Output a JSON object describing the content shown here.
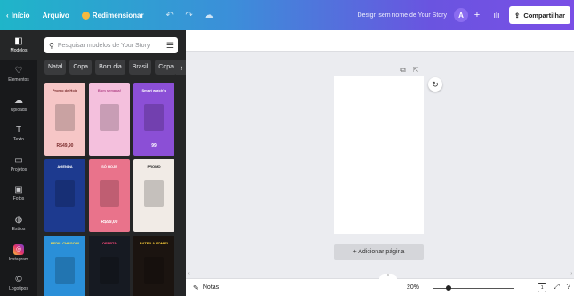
{
  "topbar": {
    "home_label": "Início",
    "file_label": "Arquivo",
    "resize_label": "Redimensionar",
    "design_name": "Design sem nome de Your Story",
    "avatar_initial": "A",
    "share_label": "Compartilhar",
    "gradient_colors": [
      "#1fb5c9",
      "#3b8fd9",
      "#6a54e0",
      "#7a4fe6"
    ]
  },
  "rail": {
    "items": [
      {
        "label": "Modelos",
        "icon": "templates-icon",
        "glyph": "◧"
      },
      {
        "label": "Elementos",
        "icon": "shapes-icon",
        "glyph": "♡"
      },
      {
        "label": "Uploads",
        "icon": "upload-cloud-icon",
        "glyph": "☁"
      },
      {
        "label": "Texto",
        "icon": "text-icon",
        "glyph": "T"
      },
      {
        "label": "Projetos",
        "icon": "folder-icon",
        "glyph": "▭"
      },
      {
        "label": "Fotos",
        "icon": "photo-icon",
        "glyph": "▣"
      },
      {
        "label": "Estilos",
        "icon": "palette-icon",
        "glyph": "◍"
      },
      {
        "label": "Instagram",
        "icon": "instagram-icon",
        "glyph": "◎"
      },
      {
        "label": "Logotipos",
        "icon": "logo-icon",
        "glyph": "©"
      }
    ]
  },
  "panel": {
    "search_placeholder": "Pesquisar modelos de Your Story",
    "chips": [
      "Natal",
      "Copa",
      "Bom dia",
      "Brasil",
      "Copa"
    ],
    "templates": [
      {
        "title": "Promo de Hoje",
        "bg": "#f6c6c6",
        "price": "R$49,90"
      },
      {
        "title": "Bom semana!",
        "bg": "#f4c0dd",
        "price": ""
      },
      {
        "title": "Smart watch's",
        "bg": "#8b4fd6",
        "price": "99"
      },
      {
        "title": "AGENDA",
        "bg": "#1d3a8f",
        "price": ""
      },
      {
        "title": "SÓ HOJE",
        "bg": "#e9738b",
        "price": "R$99,00"
      },
      {
        "title": "PROMO",
        "bg": "#f1ebe6",
        "price": ""
      },
      {
        "title": "PEDIU CHEGOU!",
        "bg": "#2a8fd8",
        "price": ""
      },
      {
        "title": "OFERTA",
        "bg": "#161a22",
        "price": ""
      },
      {
        "title": "BATEU A FOME?",
        "bg": "#1b1410",
        "price": ""
      }
    ]
  },
  "canvas": {
    "add_page_label": "+ Adicionar página"
  },
  "bottombar": {
    "notes_label": "Notas",
    "zoom_label": "20%",
    "zoom_fraction": 0.2,
    "page_count": "1"
  }
}
